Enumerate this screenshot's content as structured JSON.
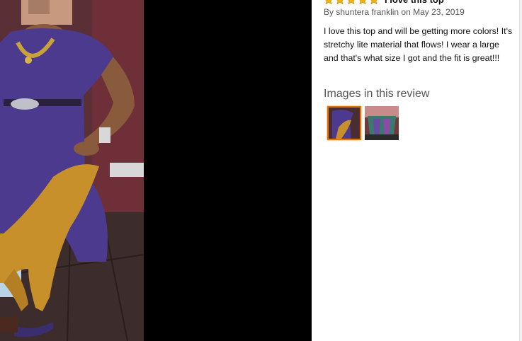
{
  "review": {
    "rating_stars": 5,
    "title": "I love this top",
    "byline_prefix": "By",
    "author": "shuntera franklin",
    "date_text": "on May 23, 2019",
    "body": "I love this top and will be getting more colors! It's stretchy lite material that flows! I wear a large and that's what size I got and the fit is great!!!"
  },
  "images_section": {
    "heading": "Images in this review",
    "selected_index": 0
  },
  "colors": {
    "star": "#f4b400",
    "selected_border": "#e77600",
    "dress": "#4b3a8e",
    "leggings": "#c8902a"
  }
}
